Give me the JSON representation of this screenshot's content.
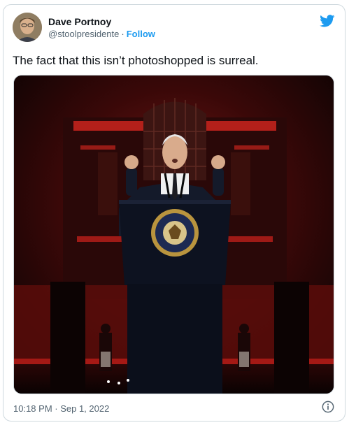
{
  "tweet": {
    "author_name": "Dave Portnoy",
    "author_handle": "@stoolpresidente",
    "separator": "·",
    "follow_label": "Follow",
    "text": "The fact that this isn’t photoshopped is surreal.",
    "timestamp": "10:18 PM · Sep 1, 2022"
  },
  "icons": {
    "brand": "twitter-bird-icon",
    "info": "info-icon"
  },
  "colors": {
    "accent": "#1d9bf0",
    "text": "#0f1419",
    "muted": "#536471",
    "border": "#cfd9de",
    "stage_red": "#8a1010"
  }
}
